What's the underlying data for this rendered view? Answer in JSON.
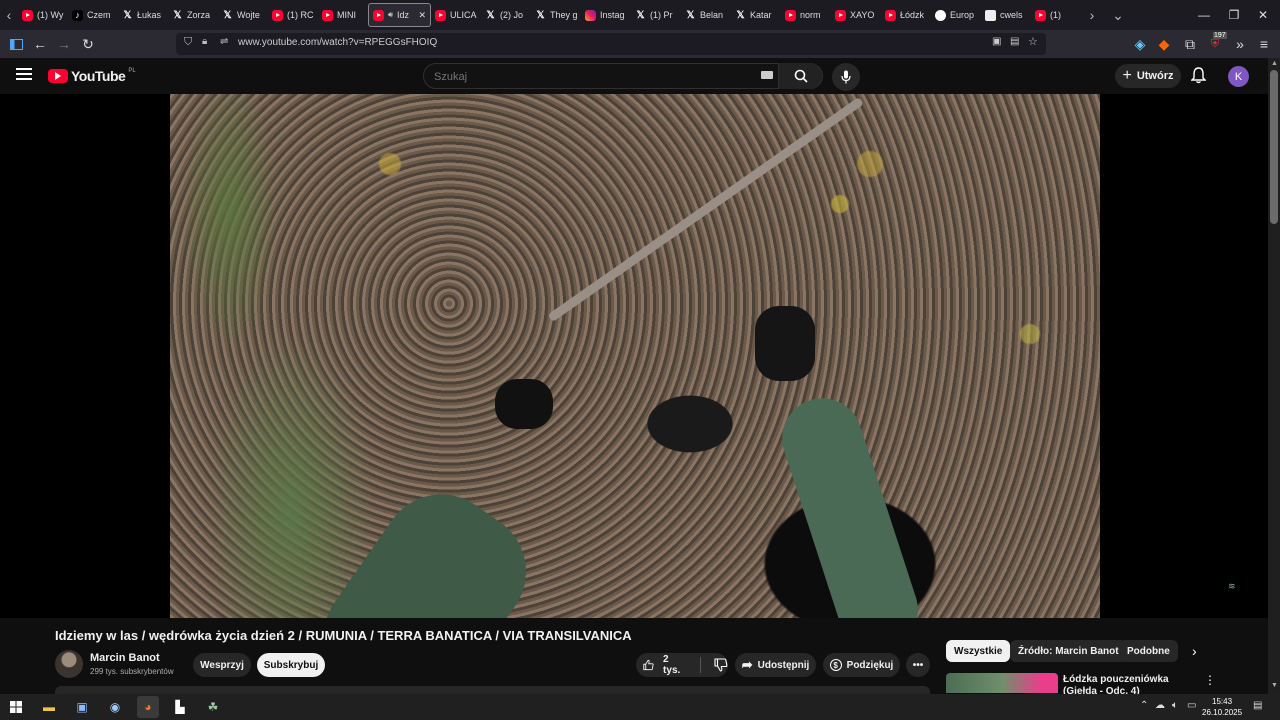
{
  "browser": {
    "tabs": [
      {
        "label": "(1) Wy",
        "icon": "youtube-icon"
      },
      {
        "label": "Czem",
        "icon": "tiktok-icon"
      },
      {
        "label": "Łukas",
        "icon": "x-icon"
      },
      {
        "label": "Zorza",
        "icon": "x-icon"
      },
      {
        "label": "Wojte",
        "icon": "x-icon"
      },
      {
        "label": "(1) RC",
        "icon": "youtube-icon"
      },
      {
        "label": "MINI",
        "icon": "youtube-icon"
      },
      {
        "label": "Idz",
        "icon": "youtube-icon",
        "active": true
      },
      {
        "label": "ULICA",
        "icon": "youtube-icon"
      },
      {
        "label": "(2) Jo",
        "icon": "x-icon"
      },
      {
        "label": "They g",
        "icon": "x-icon"
      },
      {
        "label": "Instag",
        "icon": "instagram-icon"
      },
      {
        "label": "(1) Pr",
        "icon": "x-icon"
      },
      {
        "label": "Belan",
        "icon": "x-icon"
      },
      {
        "label": "Katar",
        "icon": "x-icon"
      },
      {
        "label": "norm",
        "icon": "youtube-icon"
      },
      {
        "label": "XAYO",
        "icon": "youtube-icon"
      },
      {
        "label": "Łódzk",
        "icon": "youtube-icon"
      },
      {
        "label": "Europ",
        "icon": "globe-icon"
      },
      {
        "label": "cwels",
        "icon": "page-icon"
      },
      {
        "label": "(1) ",
        "icon": "youtube-icon"
      }
    ],
    "url": "www.youtube.com/watch?v=RPEGGsFHOIQ",
    "extension_badge": "197"
  },
  "youtube": {
    "logo_text": "YouTube",
    "region": "PL",
    "search_placeholder": "Szukaj",
    "create_label": "Utwórz",
    "avatar_letter": "K"
  },
  "video": {
    "title": "Idziemy w las / wędrówka życia dzień 2 / RUMUNIA / TERRA BANATICA / VIA TRANSILVANICA",
    "channel": "Marcin Banot",
    "subscribers": "299 tys. subskrybentów",
    "support_label": "Wesprzyj",
    "subscribe_label": "Subskrybuj",
    "likes": "2 tys.",
    "share_label": "Udostępnij",
    "thanks_label": "Podziękuj"
  },
  "sidebar": {
    "chips": [
      "Wszystkie",
      "Źródło: Marcin Banot",
      "Podobne"
    ],
    "recommended_title": "Łódzka pouczeniówka (Giełda - Odc. 4)"
  },
  "taskbar": {
    "time": "15:43",
    "date": "26.10.2025"
  }
}
